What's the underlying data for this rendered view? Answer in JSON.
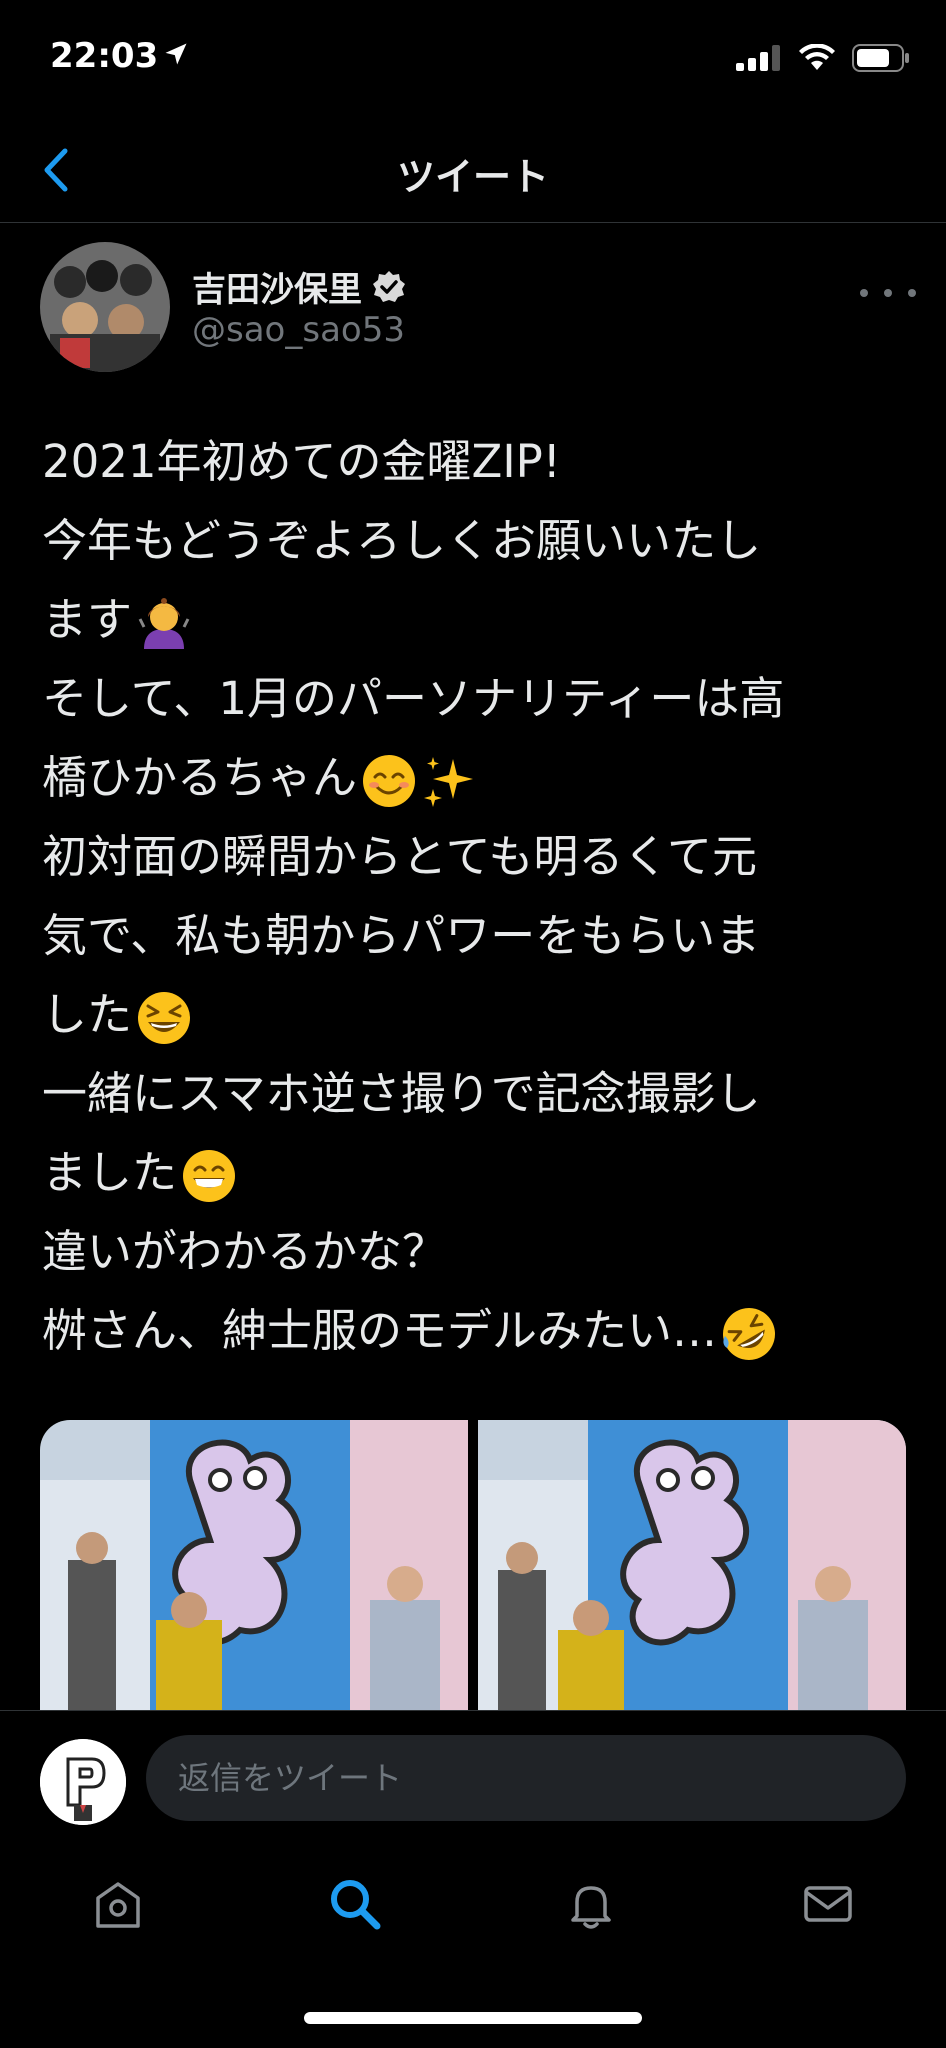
{
  "status": {
    "time": "22:03"
  },
  "nav": {
    "title": "ツイート"
  },
  "tweet": {
    "author_name": "吉田沙保里",
    "author_handle": "@sao_sao53",
    "lines": [
      "2021年初めての金曜ZIP!",
      "今年もどうぞよろしくお願いいたし",
      "ます",
      "そして、1月のパーソナリティーは高",
      "橋ひかるちゃん",
      "初対面の瞬間からとても明るくて元",
      "気で、私も朝からパワーをもらいま",
      "した",
      "一緒にスマホ逆さ撮りで記念撮影し",
      "ました",
      "違いがわかるかな？",
      "桝さん、紳士服のモデルみたい…"
    ]
  },
  "reply": {
    "placeholder": "返信をツイート"
  },
  "tabs": [
    "home-icon",
    "search-icon",
    "bell-icon",
    "mail-icon"
  ],
  "colors": {
    "accent": "#1d9bf0",
    "background": "#000000",
    "text": "#e7e9ea",
    "muted": "#71767b"
  }
}
